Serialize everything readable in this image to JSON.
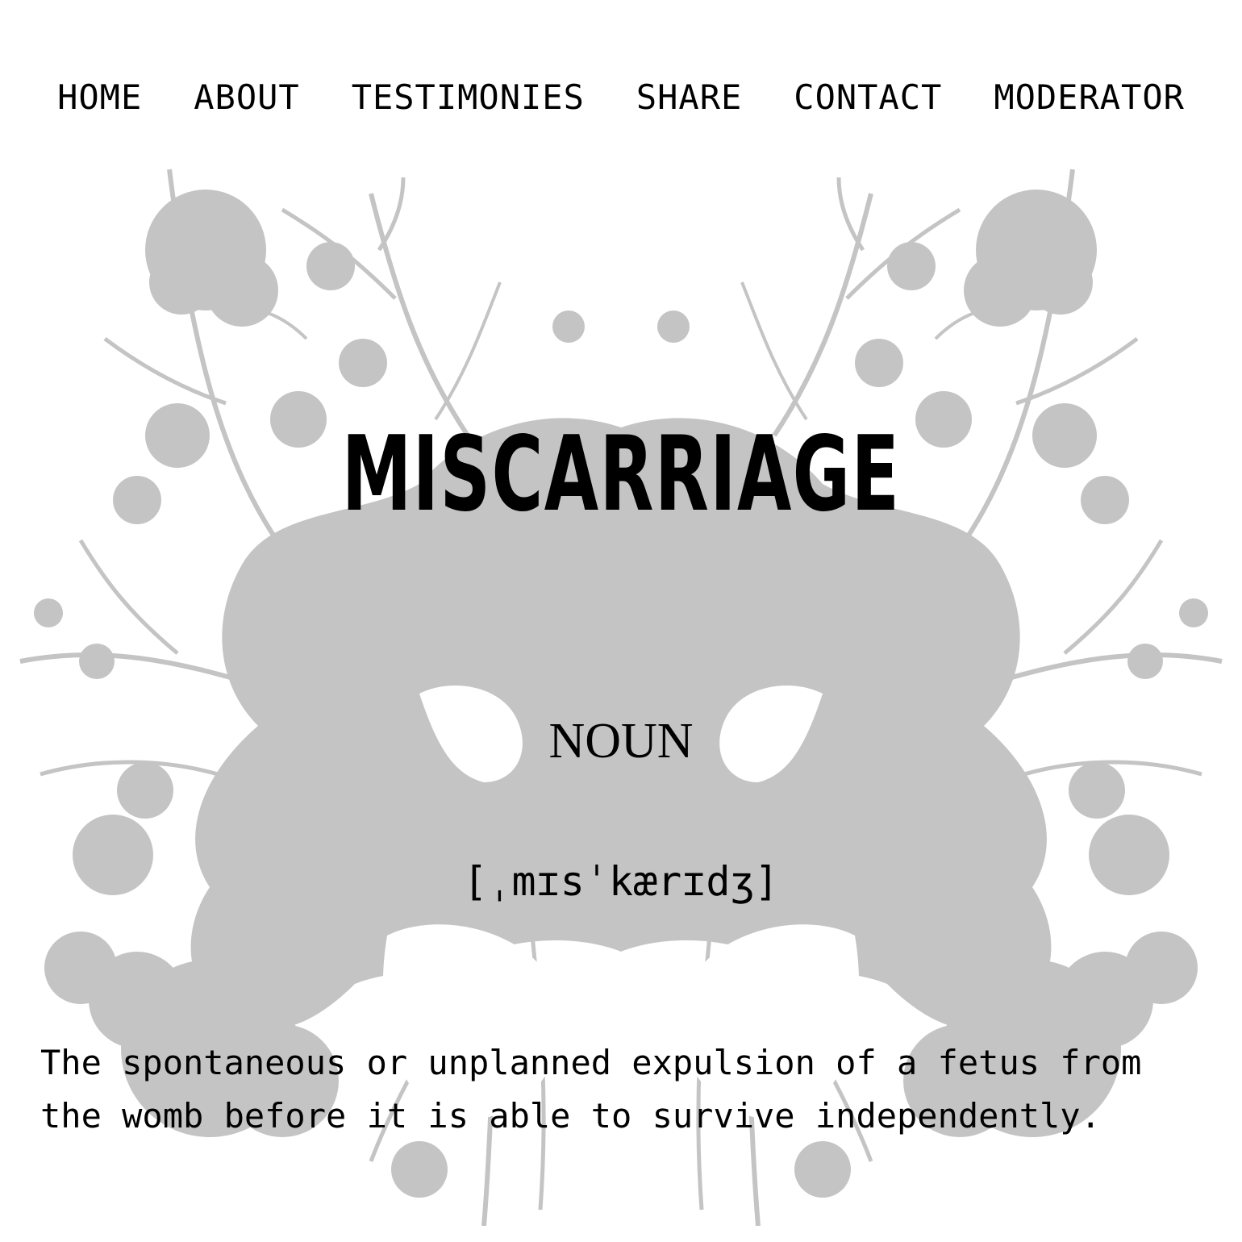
{
  "nav": {
    "items": [
      {
        "label": "HOME"
      },
      {
        "label": "ABOUT"
      },
      {
        "label": "TESTIMONIES"
      },
      {
        "label": "SHARE"
      },
      {
        "label": "CONTACT"
      },
      {
        "label": "MODERATOR"
      }
    ]
  },
  "hero": {
    "title": "MISCARRIAGE",
    "part_of_speech": "NOUN",
    "pronunciation": "[ˌmɪsˈkærɪdʒ]",
    "definition": "The spontaneous or unplanned expulsion of a fetus from the womb before it is able to survive independently."
  },
  "colors": {
    "background": "#ffffff",
    "text": "#000000",
    "art_fill": "#c4c4c4"
  }
}
